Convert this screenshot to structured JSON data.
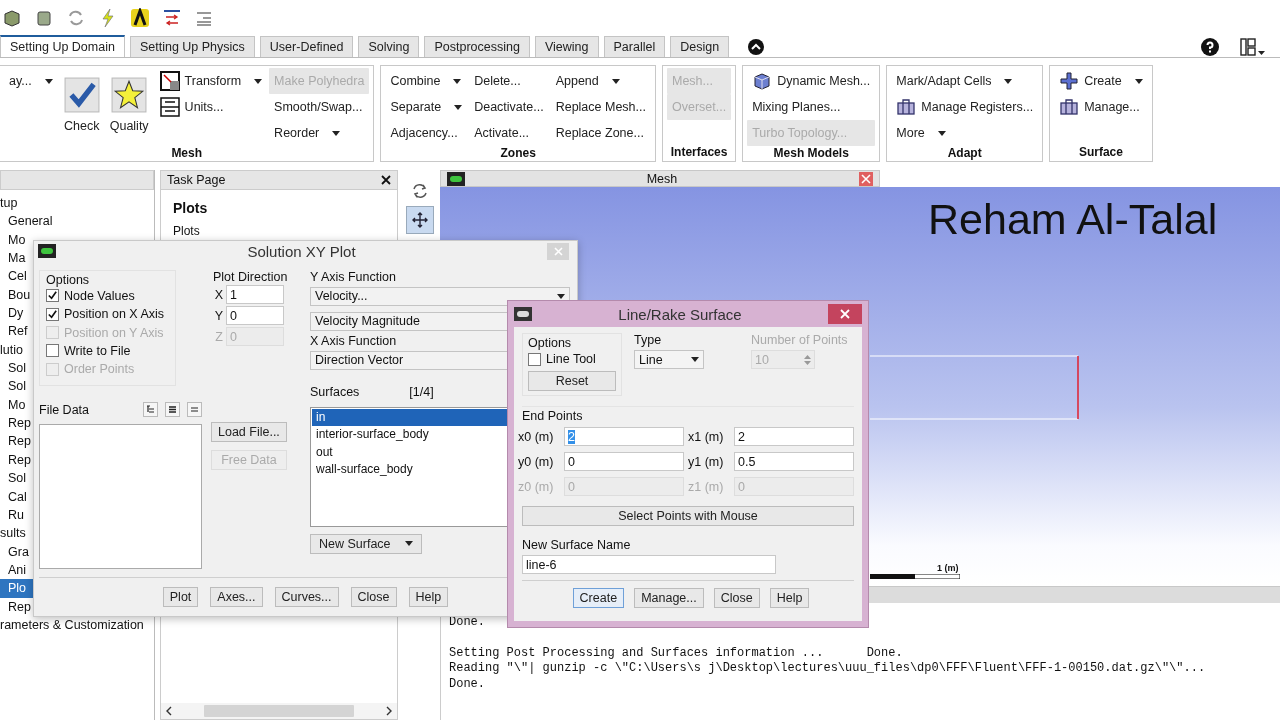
{
  "ribbon": {
    "tabs": [
      {
        "label": "Setting Up Domain",
        "selected": true
      },
      {
        "label": "Setting Up Physics",
        "selected": false
      },
      {
        "label": "User-Defined",
        "selected": false
      },
      {
        "label": "Solving",
        "selected": false
      },
      {
        "label": "Postprocessing",
        "selected": false
      },
      {
        "label": "Viewing",
        "selected": false
      },
      {
        "label": "Parallel",
        "selected": false
      },
      {
        "label": "Design",
        "selected": false
      }
    ],
    "groups": [
      {
        "title": "Mesh",
        "columns": [
          [
            {
              "label": "ay...",
              "kind": "small",
              "disabled": false,
              "menu": true
            }
          ],
          [
            {
              "label": "Check",
              "kind": "large",
              "disabled": false,
              "menu": false
            }
          ],
          [
            {
              "label": "Quality",
              "kind": "large",
              "disabled": false,
              "menu": false
            }
          ],
          [
            {
              "label": "Transform",
              "kind": "small",
              "disabled": false,
              "menu": true
            },
            {
              "label": "Units...",
              "kind": "small",
              "disabled": false,
              "menu": false
            }
          ],
          [
            {
              "label": "Make Polyhedra",
              "kind": "small",
              "disabled": true,
              "menu": false
            },
            {
              "label": "Smooth/Swap...",
              "kind": "small",
              "disabled": false,
              "menu": false
            },
            {
              "label": "Reorder",
              "kind": "small",
              "disabled": false,
              "menu": true
            }
          ]
        ]
      },
      {
        "title": "Zones",
        "columns": [
          [
            {
              "label": "Combine",
              "kind": "small",
              "disabled": false,
              "menu": true
            },
            {
              "label": "Separate",
              "kind": "small",
              "disabled": false,
              "menu": true
            },
            {
              "label": "Adjacency...",
              "kind": "small",
              "disabled": false,
              "menu": false
            }
          ],
          [
            {
              "label": "Delete...",
              "kind": "small",
              "disabled": false,
              "menu": false
            },
            {
              "label": "Deactivate...",
              "kind": "small",
              "disabled": false,
              "menu": false
            },
            {
              "label": "Activate...",
              "kind": "small",
              "disabled": false,
              "menu": false
            }
          ],
          [
            {
              "label": "Append",
              "kind": "small",
              "disabled": false,
              "menu": true
            },
            {
              "label": "Replace Mesh...",
              "kind": "small",
              "disabled": false,
              "menu": false
            },
            {
              "label": "Replace Zone...",
              "kind": "small",
              "disabled": false,
              "menu": false
            }
          ]
        ]
      },
      {
        "title": "Interfaces",
        "columns": [
          [
            {
              "label": "Mesh...",
              "kind": "small",
              "disabled": true,
              "menu": false
            },
            {
              "label": "Overset...",
              "kind": "small",
              "disabled": true,
              "menu": false
            }
          ]
        ]
      },
      {
        "title": "Mesh Models",
        "columns": [
          [
            {
              "label": "Dynamic Mesh...",
              "kind": "small",
              "disabled": false,
              "menu": false
            },
            {
              "label": "Mixing Planes...",
              "kind": "small",
              "disabled": false,
              "menu": false
            },
            {
              "label": "Turbo Topology...",
              "kind": "small",
              "disabled": true,
              "menu": false
            }
          ]
        ]
      },
      {
        "title": "Adapt",
        "columns": [
          [
            {
              "label": "Mark/Adapt Cells",
              "kind": "small",
              "disabled": false,
              "menu": true
            },
            {
              "label": "Manage Registers...",
              "kind": "small",
              "disabled": false,
              "menu": false
            },
            {
              "label": "More",
              "kind": "small",
              "disabled": false,
              "menu": true
            }
          ]
        ]
      },
      {
        "title": "Surface",
        "columns": [
          [
            {
              "label": "Create",
              "kind": "small",
              "disabled": false,
              "menu": true
            },
            {
              "label": "Manage...",
              "kind": "small",
              "disabled": false,
              "menu": false
            }
          ]
        ]
      }
    ]
  },
  "tree": {
    "items": [
      {
        "label": "tup",
        "selected": false,
        "children": [
          {
            "label": "General",
            "selected": false
          },
          {
            "label": "Mo",
            "selected": false
          },
          {
            "label": "Ma",
            "selected": false
          },
          {
            "label": "Cel",
            "selected": false
          },
          {
            "label": "Bou",
            "selected": false
          },
          {
            "label": "Dy",
            "selected": false
          },
          {
            "label": "Ref",
            "selected": false
          }
        ]
      },
      {
        "label": "lutio",
        "selected": false,
        "children": [
          {
            "label": "Sol",
            "selected": false
          },
          {
            "label": "Sol",
            "selected": false
          },
          {
            "label": "Mo",
            "selected": false
          },
          {
            "label": "Rep",
            "selected": false
          },
          {
            "label": "Rep",
            "selected": false
          },
          {
            "label": "Rep",
            "selected": false
          },
          {
            "label": "Sol",
            "selected": false
          },
          {
            "label": "Cal",
            "selected": false
          },
          {
            "label": "Ru",
            "selected": false
          }
        ]
      },
      {
        "label": "sults",
        "selected": false,
        "children": [
          {
            "label": "Gra",
            "selected": false
          },
          {
            "label": "Ani",
            "selected": false
          },
          {
            "label": "Plo",
            "selected": true
          },
          {
            "label": "Rep",
            "selected": false
          }
        ]
      },
      {
        "label": "rameters & Customization",
        "selected": false
      }
    ]
  },
  "task_page": {
    "title": "Task Page",
    "heading": "Plots",
    "subheading": "Plots"
  },
  "graphics": {
    "title": "Mesh",
    "overlay_caption": "Reham Al-Talal",
    "scale_label": "1 (m)"
  },
  "console": {
    "blocks": [
      [
        "Done."
      ],
      [
        "Setting Post Processing and Surfaces information ...      Done.",
        "Reading \"\\\"| gunzip -c \\\"C:\\Users\\s j\\Desktop\\lectures\\uuu_files\\dp0\\FFF\\Fluent\\FFF-1-00150.dat.gz\\\"\\\"...",
        "Done."
      ]
    ]
  },
  "xy_plot": {
    "title": "Solution XY Plot",
    "options": {
      "title": "Options",
      "items": [
        {
          "label": "Node Values",
          "checked": true,
          "disabled": false
        },
        {
          "label": "Position on X Axis",
          "checked": true,
          "disabled": false
        },
        {
          "label": "Position on Y Axis",
          "checked": false,
          "disabled": true
        },
        {
          "label": "Write to File",
          "checked": false,
          "disabled": false
        },
        {
          "label": "Order Points",
          "checked": false,
          "disabled": true
        }
      ]
    },
    "plot_direction": {
      "title": "Plot Direction",
      "fields": [
        {
          "label": "X",
          "value": "1",
          "disabled": false
        },
        {
          "label": "Y",
          "value": "0",
          "disabled": false
        },
        {
          "label": "Z",
          "value": "0",
          "disabled": true
        }
      ]
    },
    "y_axis_function": {
      "title": "Y Axis Function",
      "dropdowns": [
        "Velocity...",
        "Velocity Magnitude"
      ]
    },
    "x_axis_function": {
      "title": "X Axis Function",
      "dropdown": "Direction Vector"
    },
    "surfaces": {
      "title": "Surfaces",
      "count": "[1/4]",
      "items": [
        {
          "label": "in",
          "selected": true
        },
        {
          "label": "interior-surface_body",
          "selected": false
        },
        {
          "label": "out",
          "selected": false
        },
        {
          "label": "wall-surface_body",
          "selected": false
        }
      ],
      "new_surface": "New Surface"
    },
    "file_data": {
      "title": "File Data",
      "buttons": [
        {
          "label": "Load File...",
          "disabled": false
        },
        {
          "label": "Free Data",
          "disabled": true
        }
      ]
    },
    "buttons": [
      "Plot",
      "Axes...",
      "Curves...",
      "Close",
      "Help"
    ]
  },
  "rake": {
    "title": "Line/Rake Surface",
    "options": {
      "title": "Options",
      "line_tool": {
        "label": "Line Tool",
        "checked": false
      },
      "reset": "Reset"
    },
    "type": {
      "title": "Type",
      "value": "Line"
    },
    "number_of_points": {
      "title": "Number of Points",
      "value": "10",
      "disabled": true
    },
    "end_points": {
      "title": "End Points",
      "fields": [
        {
          "label": "x0 (m)",
          "value": "2",
          "disabled": false,
          "selected": true
        },
        {
          "label": "x1 (m)",
          "value": "2",
          "disabled": false,
          "selected": false
        },
        {
          "label": "y0 (m)",
          "value": "0",
          "disabled": false,
          "selected": false
        },
        {
          "label": "y1 (m)",
          "value": "0.5",
          "disabled": false,
          "selected": false
        },
        {
          "label": "z0 (m)",
          "value": "0",
          "disabled": true,
          "selected": false
        },
        {
          "label": "z1 (m)",
          "value": "0",
          "disabled": true,
          "selected": false
        }
      ]
    },
    "select_points": "Select Points with Mouse",
    "new_surface_name": {
      "label": "New Surface Name",
      "value": "line-6"
    },
    "buttons": [
      {
        "label": "Create",
        "default": true
      },
      {
        "label": "Manage...",
        "default": false
      },
      {
        "label": "Close",
        "default": false
      },
      {
        "label": "Help",
        "default": false
      }
    ]
  }
}
